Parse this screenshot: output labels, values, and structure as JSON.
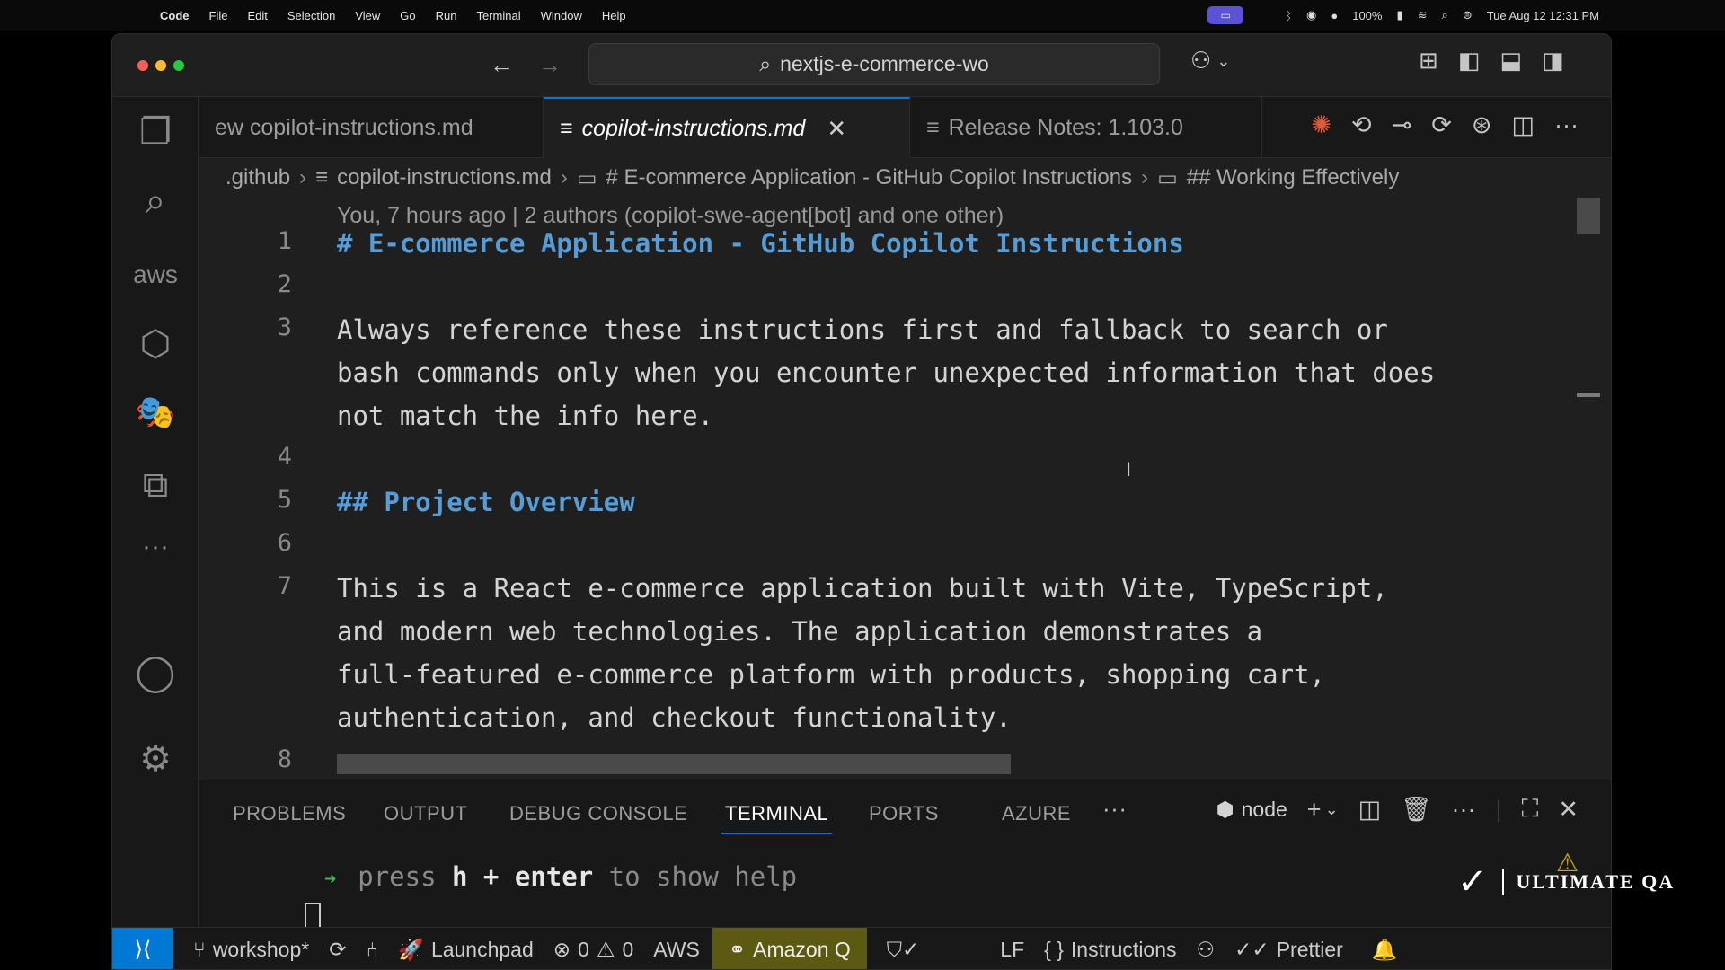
{
  "menubar": {
    "app": "Code",
    "items": [
      "File",
      "Edit",
      "Selection",
      "View",
      "Go",
      "Run",
      "Terminal",
      "Window",
      "Help"
    ],
    "battery": "100%",
    "datetime": "Tue Aug 12  12:31 PM"
  },
  "titlebar": {
    "search": "nextjs-e-commerce-wo"
  },
  "tabs": [
    {
      "label": "ew copilot-instructions.md"
    },
    {
      "label": "copilot-instructions.md"
    },
    {
      "label": "Release Notes: 1.103.0"
    }
  ],
  "breadcrumb": {
    "folder": ".github",
    "file": "copilot-instructions.md",
    "h1": "# E-commerce Application - GitHub Copilot Instructions",
    "h2": "## Working Effectively"
  },
  "editor": {
    "codelens": "You, 7 hours ago | 2 authors (copilot-swe-agent[bot] and one other)",
    "line_numbers": [
      "1",
      "2",
      "3",
      "4",
      "5",
      "6",
      "7",
      "8"
    ],
    "lines": {
      "l1": "# E-commerce Application - GitHub Copilot Instructions",
      "l3a": "Always reference these instructions first and fallback to search or",
      "l3b": "bash commands only when you encounter unexpected information that does",
      "l3c": "not match the info here.",
      "l5": "## Project Overview",
      "l7a": "This is a React e-commerce application built with Vite, TypeScript,",
      "l7b": "and modern web technologies. The application demonstrates a",
      "l7c": "full-featured e-commerce platform with products, shopping cart,",
      "l7d": "authentication, and checkout functionality."
    }
  },
  "panel": {
    "tabs": [
      "PROBLEMS",
      "OUTPUT",
      "DEBUG CONSOLE",
      "TERMINAL",
      "PORTS",
      "AZURE"
    ],
    "active_tab": "TERMINAL",
    "shell": "node",
    "terminal": {
      "w1": "press ",
      "w2": "h + enter",
      "w3": " to show help"
    }
  },
  "statusbar": {
    "branch": "workshop*",
    "launchpad": "Launchpad",
    "errors": "0",
    "warnings": "0",
    "aws": "AWS",
    "amazonq": "Amazon Q",
    "eol": "LF",
    "language": "Instructions",
    "prettier": "Prettier"
  },
  "watermark": "ULTIMATE QA"
}
